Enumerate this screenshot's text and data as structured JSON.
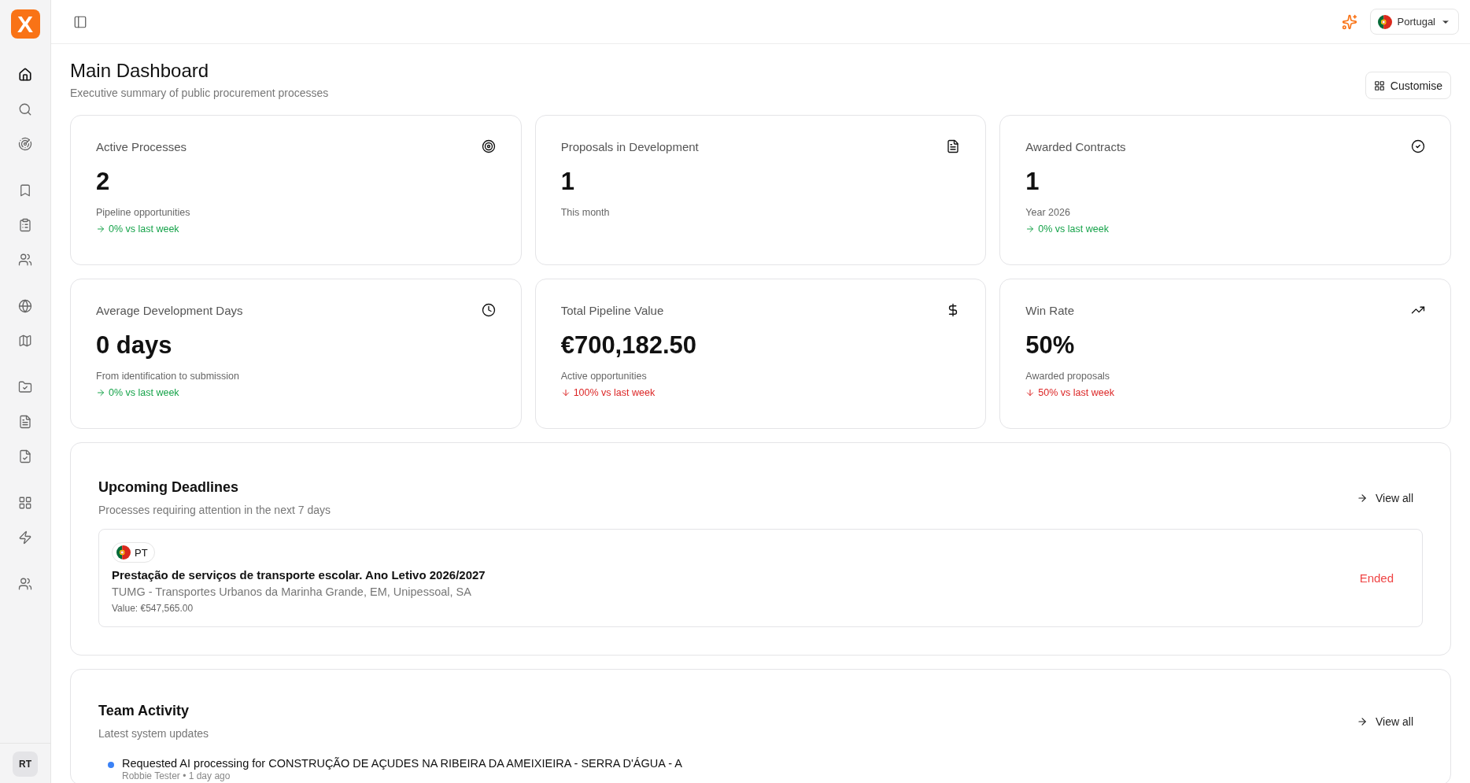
{
  "sidebar": {
    "logo": "X",
    "groups": [
      [
        {
          "selected": true
        },
        {
          "selected": false
        },
        {
          "selected": false
        }
      ],
      [
        {
          "selected": false
        },
        {
          "selected": false
        },
        {
          "selected": false
        }
      ],
      [
        {
          "selected": false
        },
        {
          "selected": false
        }
      ],
      [
        {
          "selected": false
        },
        {
          "selected": false
        },
        {
          "selected": false
        }
      ],
      [
        {
          "selected": false
        },
        {
          "selected": false
        }
      ],
      [
        {
          "selected": false
        }
      ]
    ],
    "avatar": "RT"
  },
  "topbar": {
    "country": "Portugal"
  },
  "header": {
    "title": "Main Dashboard",
    "subtitle": "Executive summary of public procurement processes",
    "customise": "Customise"
  },
  "stats": [
    {
      "label": "Active Processes",
      "value": "2",
      "note": "Pipeline opportunities",
      "delta": {
        "text": "0% vs last week",
        "kind": "flat"
      }
    },
    {
      "label": "Proposals in Development",
      "value": "1",
      "note": "This month"
    },
    {
      "label": "Awarded Contracts",
      "value": "1",
      "note": "Year 2026",
      "delta": {
        "text": "0% vs last week",
        "kind": "flat"
      }
    },
    {
      "label": "Average Development Days",
      "value": "0 days",
      "note": "From identification to submission",
      "delta": {
        "text": "0% vs last week",
        "kind": "flat"
      }
    },
    {
      "label": "Total Pipeline Value",
      "value": "€700,182.50",
      "note": "Active opportunities",
      "delta": {
        "text": "100% vs last week",
        "kind": "down"
      }
    },
    {
      "label": "Win Rate",
      "value": "50%",
      "note": "Awarded proposals",
      "delta": {
        "text": "50% vs last week",
        "kind": "down"
      }
    }
  ],
  "deadlines": {
    "title": "Upcoming Deadlines",
    "subtitle": "Processes requiring attention in the next 7 days",
    "view_all": "View all",
    "items": [
      {
        "country": "PT",
        "title": "Prestação de serviços de transporte escolar. Ano Letivo 2026/2027",
        "entity": "TUMG - Transportes Urbanos da Marinha Grande, EM, Unipessoal, SA",
        "value": "Value: €547,565.00",
        "status": "Ended"
      }
    ]
  },
  "activity": {
    "title": "Team Activity",
    "subtitle": "Latest system updates",
    "view_all": "View all",
    "items": [
      {
        "text": "Requested AI processing for CONSTRUÇÃO DE AÇUDES NA RIBEIRA DA AMEIXIEIRA - SERRA D'ÁGUA - A",
        "meta": "Robbie Tester • 1 day ago",
        "color": "#3b82f6"
      }
    ]
  }
}
